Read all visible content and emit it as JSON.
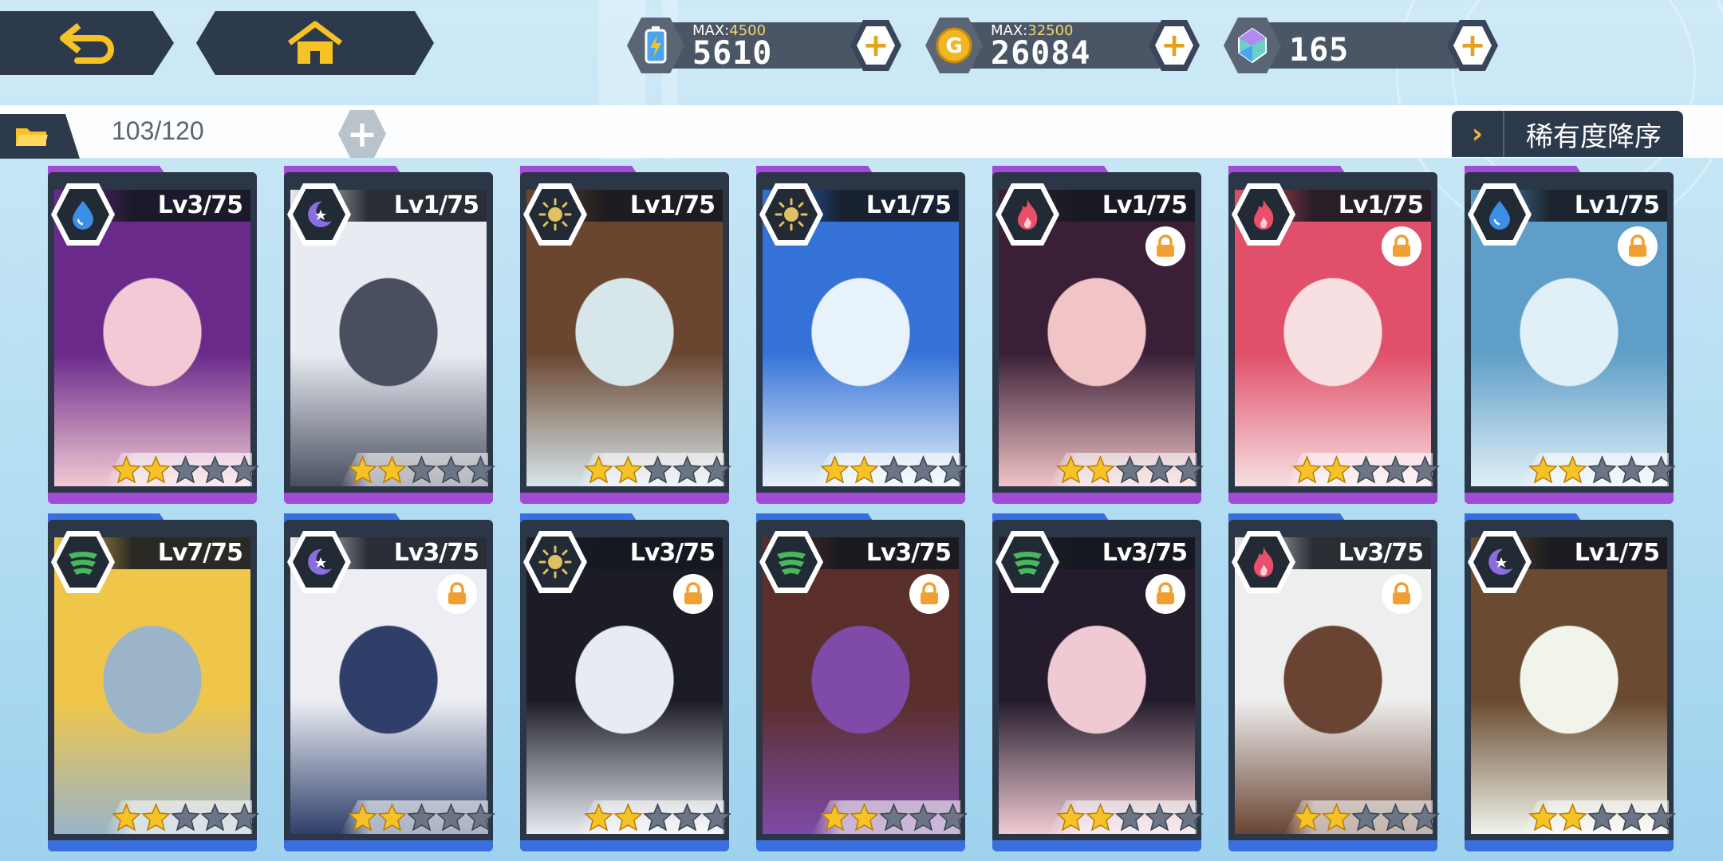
{
  "resources": {
    "stamina": {
      "max_label": "MAX:",
      "max_value": "4500",
      "value": "5610"
    },
    "gold": {
      "max_label": "MAX:",
      "max_value": "32500",
      "value": "26084"
    },
    "gems": {
      "value": "165"
    }
  },
  "roster": {
    "count": "103/120",
    "sort_label": "稀有度降序",
    "sort_chevron": "›"
  },
  "colors": {
    "purple_frame": "#a24bd6",
    "blue_frame": "#3a6fe0",
    "water": "#3c8ee6",
    "moon": "#8a6ee0",
    "sun": "#e0c060",
    "fire": "#e8506a",
    "wind": "#48b85e",
    "star_filled": "#f6c226",
    "star_empty": "#6b7585"
  },
  "cards": [
    {
      "level": "Lv3/75",
      "element": "water-icon",
      "locked": false,
      "stars": 2,
      "frame": "purple",
      "art": [
        "#6a2a8a",
        "#f2c9d4"
      ]
    },
    {
      "level": "Lv1/75",
      "element": "moon-icon",
      "locked": false,
      "stars": 2,
      "frame": "purple",
      "art": [
        "#e8ecf2",
        "#4a4f60"
      ]
    },
    {
      "level": "Lv1/75",
      "element": "sun-icon",
      "locked": false,
      "stars": 2,
      "frame": "purple",
      "art": [
        "#6a4630",
        "#d7e6ea"
      ]
    },
    {
      "level": "Lv1/75",
      "element": "sun-icon",
      "locked": false,
      "stars": 2,
      "frame": "purple",
      "art": [
        "#3572d8",
        "#e8f2fa"
      ]
    },
    {
      "level": "Lv1/75",
      "element": "fire-icon",
      "locked": true,
      "stars": 2,
      "frame": "purple",
      "art": [
        "#3a1f36",
        "#f1c4c6"
      ]
    },
    {
      "level": "Lv1/75",
      "element": "fire-icon",
      "locked": true,
      "stars": 2,
      "frame": "purple",
      "art": [
        "#e0506a",
        "#f7dfe2"
      ]
    },
    {
      "level": "Lv1/75",
      "element": "water-icon",
      "locked": true,
      "stars": 2,
      "frame": "purple",
      "art": [
        "#5f9ec8",
        "#e1eff6"
      ]
    },
    {
      "level": "Lv7/75",
      "element": "wind-icon",
      "locked": false,
      "stars": 2,
      "frame": "blue",
      "art": [
        "#f0c64a",
        "#9bb4c8"
      ]
    },
    {
      "level": "Lv3/75",
      "element": "moon-icon",
      "locked": true,
      "stars": 2,
      "frame": "blue",
      "art": [
        "#eceef4",
        "#2f3f6a"
      ]
    },
    {
      "level": "Lv3/75",
      "element": "sun-icon",
      "locked": true,
      "stars": 2,
      "frame": "blue",
      "art": [
        "#1c1c26",
        "#e8ecf2"
      ]
    },
    {
      "level": "Lv3/75",
      "element": "wind-icon",
      "locked": true,
      "stars": 2,
      "frame": "blue",
      "art": [
        "#5a2e2a",
        "#7f4aa8"
      ]
    },
    {
      "level": "Lv3/75",
      "element": "wind-icon",
      "locked": true,
      "stars": 2,
      "frame": "blue",
      "art": [
        "#241c2c",
        "#f0cad2"
      ]
    },
    {
      "level": "Lv3/75",
      "element": "fire-icon",
      "locked": true,
      "stars": 2,
      "frame": "blue",
      "art": [
        "#eeeeee",
        "#6a4432"
      ]
    },
    {
      "level": "Lv1/75",
      "element": "moon-icon",
      "locked": false,
      "stars": 2,
      "frame": "blue",
      "art": [
        "#6a4a30",
        "#f0f4ea"
      ]
    }
  ]
}
